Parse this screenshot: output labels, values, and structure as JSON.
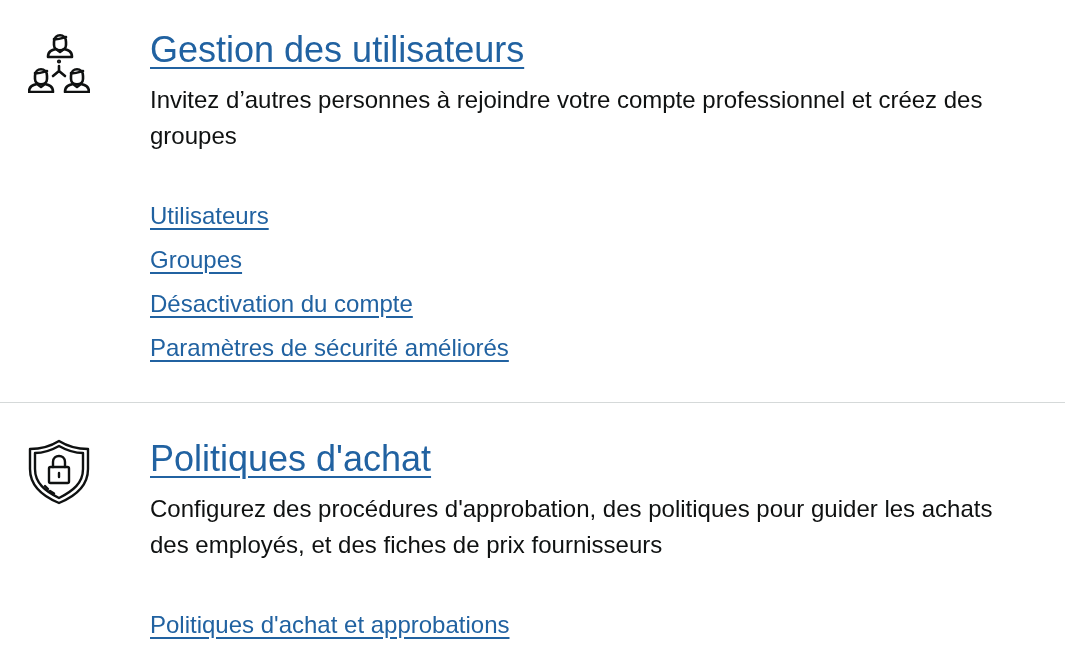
{
  "sections": [
    {
      "kind": "team",
      "title": "Gestion des utilisateurs",
      "description": "Invitez d’autres personnes à rejoindre votre compte professionnel et créez des groupes",
      "links": [
        "Utilisateurs",
        "Groupes",
        "Désactivation du compte",
        "Paramètres de sécurité améliorés"
      ]
    },
    {
      "kind": "security",
      "title": "Politiques d'achat",
      "description": "Configurez des procédures d'approbation, des politiques pour guider les achats des employés, et des fiches de prix fournisseurs",
      "links": [
        "Politiques d'achat et approbations"
      ]
    }
  ]
}
